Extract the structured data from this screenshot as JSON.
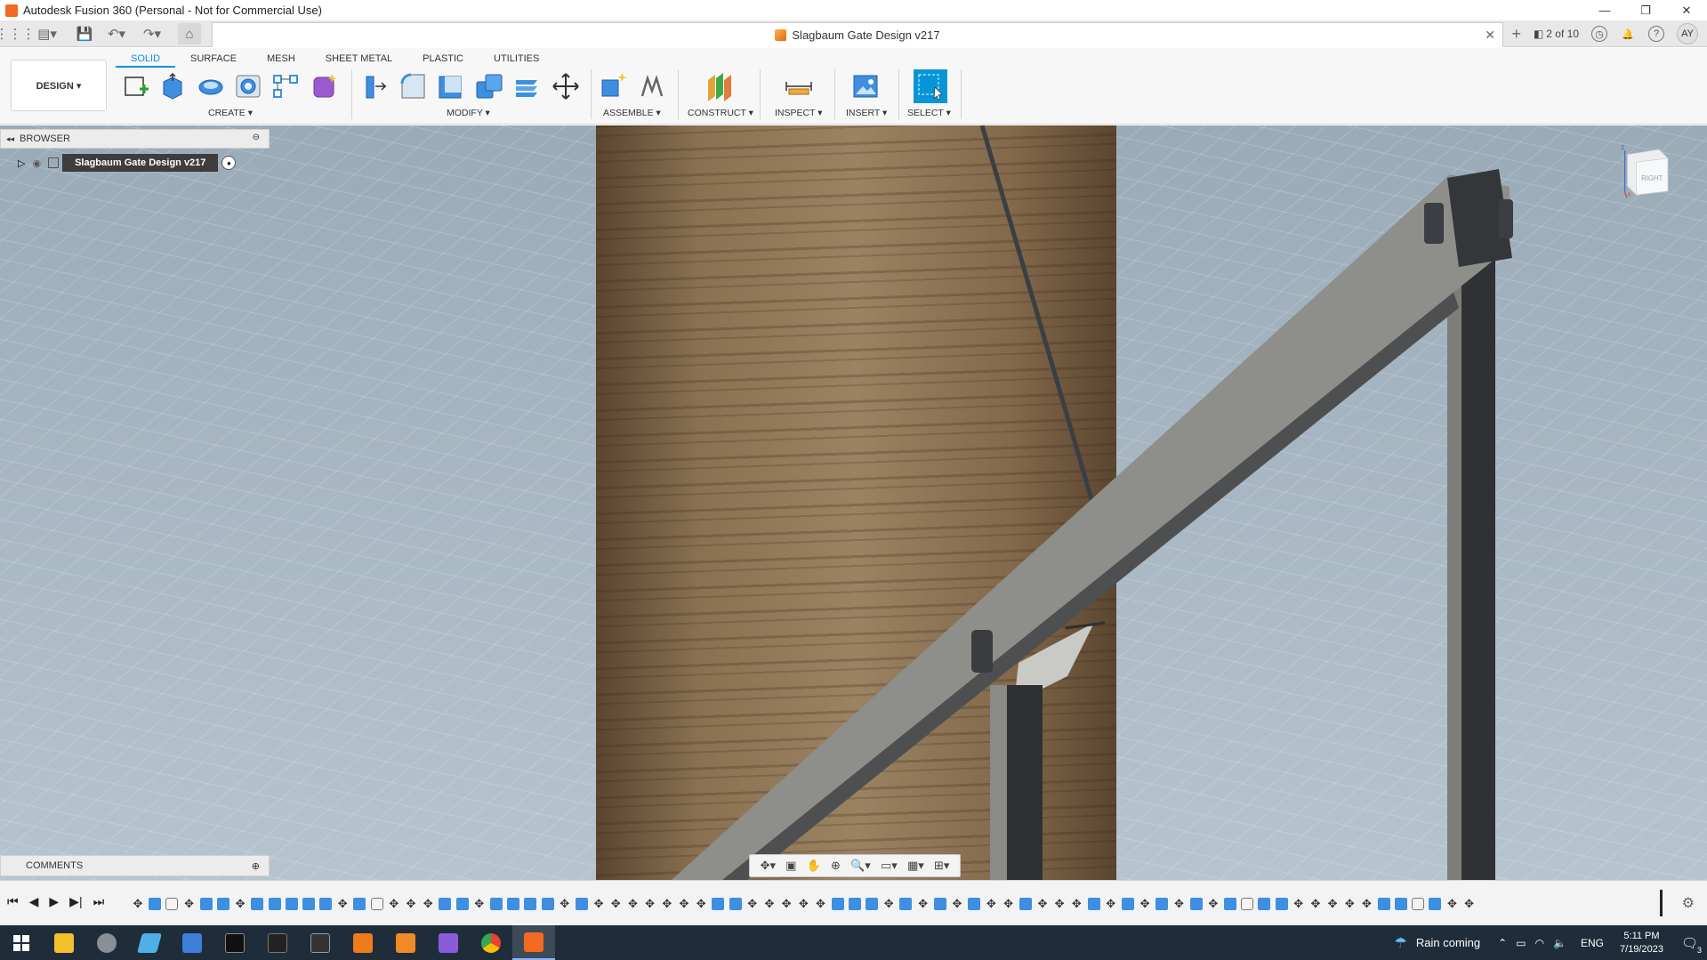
{
  "window": {
    "title": "Autodesk Fusion 360 (Personal - Not for Commercial Use)",
    "minimize": "—",
    "restore": "❐",
    "close": "✕"
  },
  "docbar": {
    "tab_title": "Slagbaum Gate Design v217",
    "tab_close": "✕",
    "add_tab": "+",
    "page_counter": "2 of 10",
    "user_initials": "AY",
    "help": "?"
  },
  "ribbon": {
    "tabs": [
      "SOLID",
      "SURFACE",
      "MESH",
      "SHEET METAL",
      "PLASTIC",
      "UTILITIES"
    ],
    "active_tab": "SOLID",
    "workspace": "DESIGN ▾",
    "groups": {
      "create": "CREATE ▾",
      "modify": "MODIFY ▾",
      "assemble": "ASSEMBLE ▾",
      "construct": "CONSTRUCT ▾",
      "inspect": "INSPECT ▾",
      "insert": "INSERT ▾",
      "select": "SELECT ▾"
    }
  },
  "browser": {
    "header": "BROWSER",
    "root_item": "Slagbaum Gate Design v217"
  },
  "comments": {
    "label": "COMMENTS"
  },
  "viewcube": {
    "face": "RIGHT",
    "axis_z": "Z",
    "axis_x": "X"
  },
  "timeline": {
    "items": [
      "m",
      "b",
      "j",
      "m",
      "b",
      "b",
      "m",
      "b",
      "b",
      "b",
      "b",
      "b",
      "m",
      "b",
      "j",
      "m",
      "m",
      "m",
      "b",
      "b",
      "m",
      "b",
      "b",
      "b",
      "b",
      "m",
      "b",
      "m",
      "m",
      "m",
      "m",
      "m",
      "m",
      "m",
      "b",
      "b",
      "m",
      "m",
      "m",
      "m",
      "m",
      "b",
      "b",
      "b",
      "m",
      "b",
      "m",
      "b",
      "m",
      "b",
      "m",
      "m",
      "b",
      "m",
      "m",
      "m",
      "b",
      "m",
      "b",
      "m",
      "b",
      "m",
      "b",
      "m",
      "b",
      "j",
      "b",
      "b",
      "m",
      "m",
      "m",
      "m",
      "m",
      "b",
      "b",
      "j",
      "b",
      "m",
      "m"
    ]
  },
  "taskbar": {
    "weather": "Rain coming",
    "language": "ENG",
    "time": "5:11 PM",
    "date": "7/19/2023",
    "notification_count": "3"
  },
  "colors": {
    "accent": "#0696d7",
    "taskbar": "#1f2d3a",
    "wood": "#8a7152",
    "steel": "#8e8e8a"
  }
}
